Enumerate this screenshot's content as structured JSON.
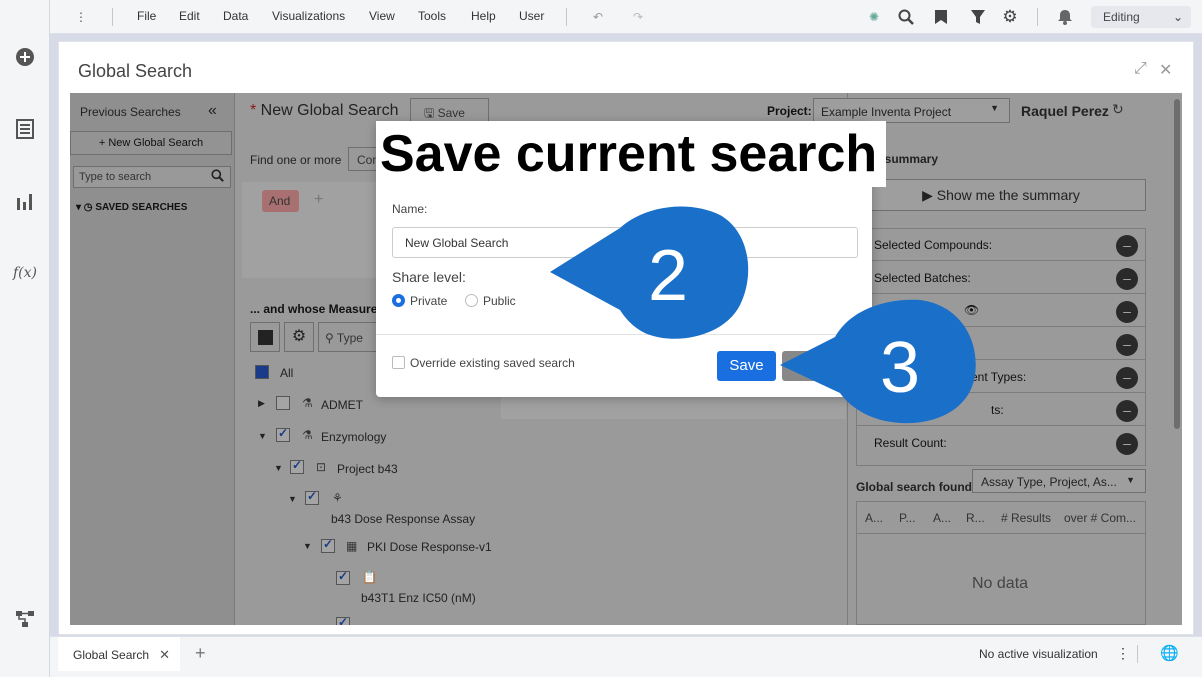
{
  "menu": {
    "items": [
      "File",
      "Edit",
      "Data",
      "Visualizations",
      "View",
      "Tools",
      "Help",
      "User"
    ],
    "mode": "Editing"
  },
  "window": {
    "title": "Global Search"
  },
  "left_panel": {
    "title": "Previous Searches",
    "new_button": "New Global Search",
    "search_placeholder": "Type to search",
    "saved_label": "SAVED SEARCHES"
  },
  "mid": {
    "search_title": "New Global Search",
    "save_label": "Save",
    "find_label": "Find one or more",
    "find_btn": "Com",
    "and_chip": "And",
    "whose_label": "... and whose Measurem",
    "type_placeholder": "Type",
    "tree": {
      "all": "All",
      "admet": "ADMET",
      "enzymology": "Enzymology",
      "project": "Project b43",
      "assay": "b43 Dose Response Assay",
      "protocol": "PKI Dose Response-v1",
      "measurement": "b43T1 Enz IC50 (nM)"
    }
  },
  "right_panel": {
    "project_label": "Project:",
    "project_value": "Example Inventa Project",
    "user": "Raquel Perez",
    "summary_label": "h summary",
    "summary_button": "Show me the summary",
    "rows": [
      "Selected Compounds:",
      "Selected Batches:",
      "",
      "",
      "ent Types:",
      "ts:",
      "Result Count:"
    ],
    "found_label": "Global search found",
    "found_select": "Assay Type, Project, As...",
    "columns": [
      "A...",
      "P...",
      "A...",
      "R...",
      "# Results",
      "over # Com..."
    ],
    "no_data": "No data"
  },
  "modal": {
    "title": "Save current search",
    "name_label": "Name:",
    "name_value": "New Global Search",
    "share_label": "Share level:",
    "options": [
      "Private",
      "Public"
    ],
    "override_label": "Override existing saved search",
    "save_button": "Save"
  },
  "callouts": {
    "step2": "2",
    "step3": "3"
  },
  "tabbar": {
    "tab": "Global Search",
    "status": "No active visualization"
  },
  "colors": {
    "accent": "#1a6fe0",
    "callout": "#1a6fc8"
  }
}
